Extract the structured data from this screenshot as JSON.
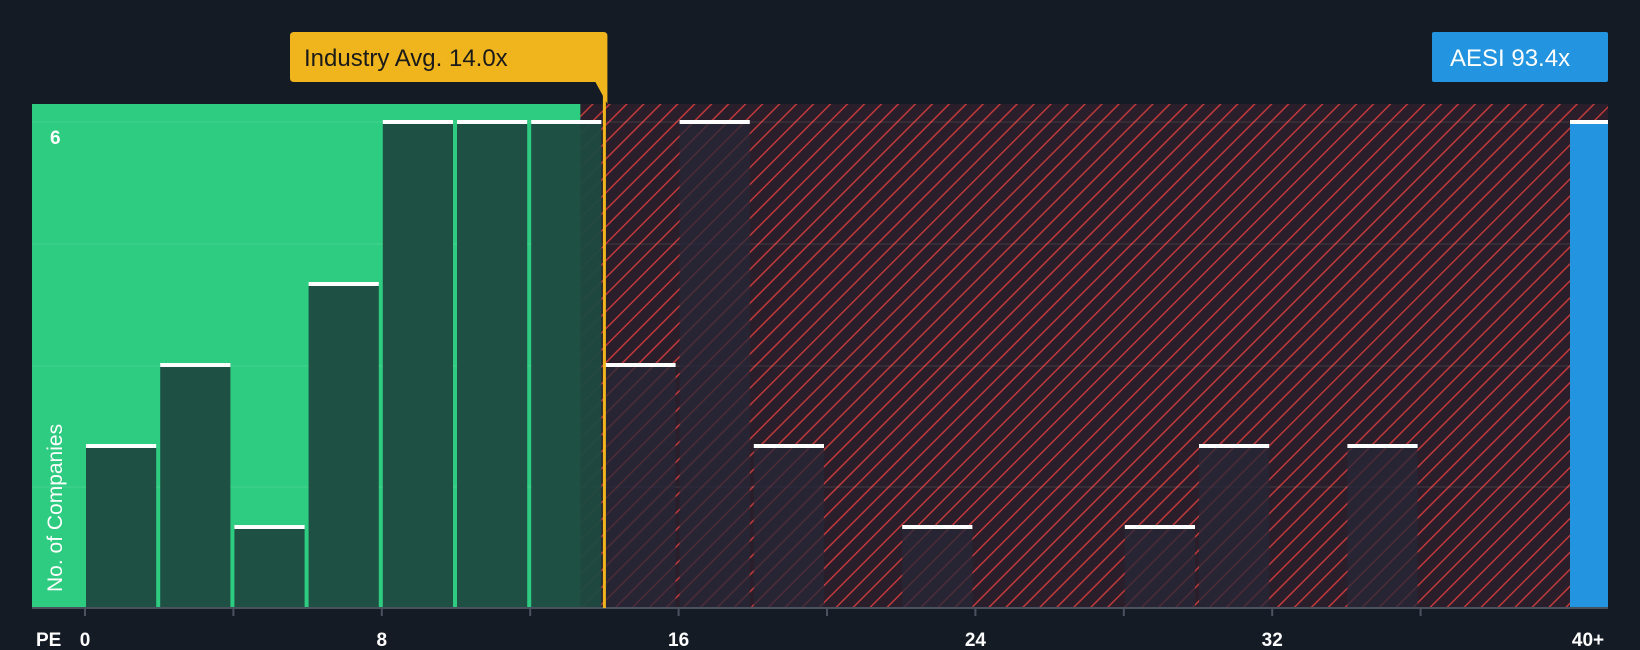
{
  "chart_data": {
    "type": "bar",
    "x_axis_label": "PE",
    "y_axis_label": "No. of Companies",
    "x_ticks": [
      "0",
      "8",
      "16",
      "24",
      "32",
      "40+"
    ],
    "y_ticks": [
      "6"
    ],
    "xlim": [
      0,
      40
    ],
    "ylim": [
      0,
      6
    ],
    "bin_width": 2,
    "bins": [
      {
        "start": 0,
        "end": 2,
        "count": 2
      },
      {
        "start": 2,
        "end": 4,
        "count": 3
      },
      {
        "start": 4,
        "end": 6,
        "count": 1
      },
      {
        "start": 6,
        "end": 8,
        "count": 4
      },
      {
        "start": 8,
        "end": 10,
        "count": 6
      },
      {
        "start": 10,
        "end": 12,
        "count": 6
      },
      {
        "start": 12,
        "end": 14,
        "count": 6
      },
      {
        "start": 14,
        "end": 16,
        "count": 3
      },
      {
        "start": 16,
        "end": 18,
        "count": 6
      },
      {
        "start": 18,
        "end": 20,
        "count": 2
      },
      {
        "start": 20,
        "end": 22,
        "count": 0
      },
      {
        "start": 22,
        "end": 24,
        "count": 1
      },
      {
        "start": 24,
        "end": 26,
        "count": 0
      },
      {
        "start": 26,
        "end": 28,
        "count": 0
      },
      {
        "start": 28,
        "end": 30,
        "count": 1
      },
      {
        "start": 30,
        "end": 32,
        "count": 2
      },
      {
        "start": 32,
        "end": 34,
        "count": 0
      },
      {
        "start": 34,
        "end": 36,
        "count": 2
      },
      {
        "start": 36,
        "end": 38,
        "count": 0
      },
      {
        "start": 38,
        "end": 40,
        "count": 0
      }
    ],
    "outlier_bin": {
      "label": "40+",
      "count": 6
    },
    "industry_avg": {
      "label": "Industry Avg. 14.0x",
      "value": 14.0
    },
    "company": {
      "label": "AESI 93.4x",
      "ticker": "AESI",
      "value": 93.4
    },
    "grid": true
  },
  "colors": {
    "background": "#151b24",
    "green_zone": "#2ecc80",
    "green_bar": "#1e4a40",
    "red_zone_bg": "#2a1e2a",
    "red_hatch": "#c0393b",
    "red_bar": "#272838",
    "bar_cap": "#ffffff",
    "industry_avg": "#f0b51c",
    "industry_avg_text": "#1a1a1a",
    "company": "#2394e0",
    "company_text": "#ffffff"
  }
}
